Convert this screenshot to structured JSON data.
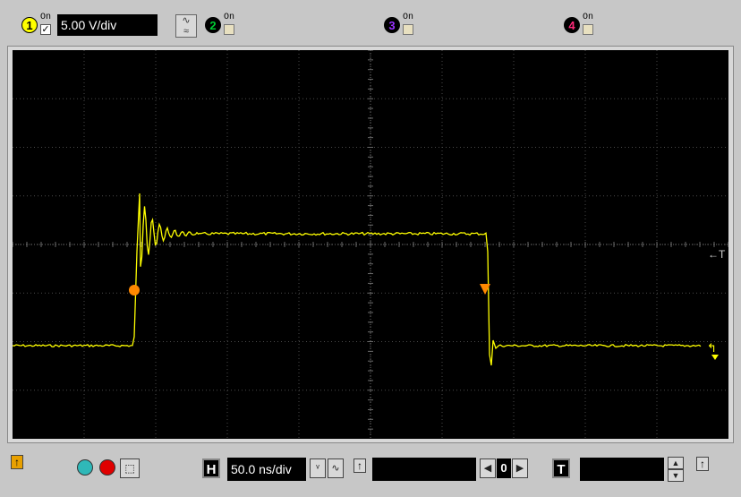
{
  "channels": [
    {
      "number": "1",
      "on_label": "On",
      "enabled": true,
      "scale": "5.00 V/div",
      "color": "#ffff00"
    },
    {
      "number": "2",
      "on_label": "On",
      "enabled": false,
      "color": "#00cc33"
    },
    {
      "number": "3",
      "on_label": "On",
      "enabled": false,
      "color": "#9933ff"
    },
    {
      "number": "4",
      "on_label": "On",
      "enabled": false,
      "color": "#ff2a7a"
    }
  ],
  "screen": {
    "trigger_label": "←T",
    "ground_marker": "↰",
    "trace_color": "#ffff00",
    "marker_color": "#ff8800"
  },
  "bottom": {
    "horizontal_label": "H",
    "timebase": "50.0 ns/div",
    "trigger_label": "T",
    "position_value": "0",
    "delay_value": "",
    "trigger_value": ""
  }
}
